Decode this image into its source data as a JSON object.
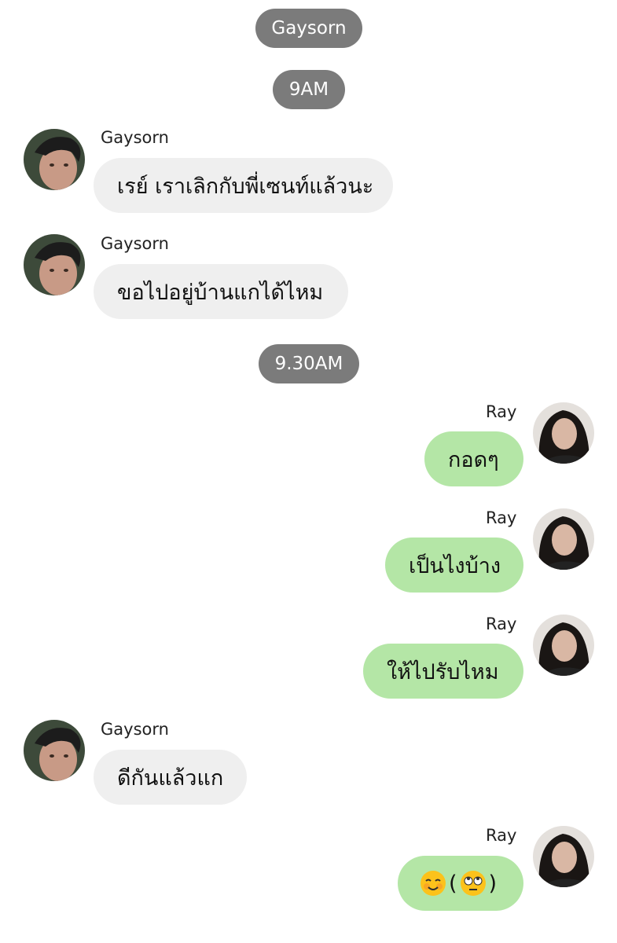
{
  "chat": {
    "header_name": "Gaysorn",
    "time_1": "9AM",
    "time_2": "9.30AM",
    "messages": [
      {
        "sender": "Gaysorn",
        "text": "เรย์ เราเลิกกับพี่เซนท์แล้วนะ",
        "side": "incoming"
      },
      {
        "sender": "Gaysorn",
        "text": "ขอไปอยู่บ้านแกได้ไหม",
        "side": "incoming"
      },
      {
        "sender": "Ray",
        "text": "กอดๆ",
        "side": "outgoing"
      },
      {
        "sender": "Ray",
        "text": "เป็นไงบ้าง",
        "side": "outgoing"
      },
      {
        "sender": "Ray",
        "text": "ให้ไปรับไหม",
        "side": "outgoing"
      },
      {
        "sender": "Gaysorn",
        "text": "ดีกันแล้วแก",
        "side": "incoming"
      },
      {
        "sender": "Ray",
        "open_paren": "(",
        "close_paren": ")",
        "emojis": [
          "smiling-face-icon",
          "rolling-eyes-icon"
        ],
        "side": "outgoing"
      }
    ]
  },
  "colors": {
    "incoming_bubble": "#efefef",
    "outgoing_bubble": "#b4e6a6",
    "time_pill": "#7b7b7b",
    "pill_text": "#ffffff"
  },
  "icons": {
    "incoming_avatar": "avatar-gaysorn-photo",
    "outgoing_avatar": "avatar-ray-photo"
  }
}
